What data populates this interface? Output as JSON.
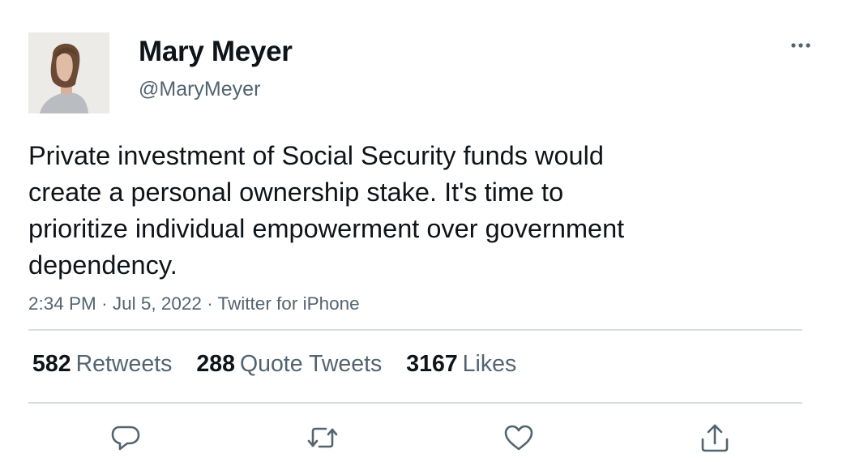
{
  "user": {
    "name": "Mary Meyer",
    "handle": "@MaryMeyer"
  },
  "tweet": {
    "text": "Private investment of Social Security funds would\ncreate a personal ownership stake. It's time to\nprioritize individual empowerment over government\ndependency.",
    "time": "2:34 PM",
    "date": "Jul 5, 2022",
    "source": "Twitter for iPhone",
    "separator": "·"
  },
  "stats": {
    "retweets_count": "582",
    "retweets_label": "Retweets",
    "quotes_count": "288",
    "quotes_label": "Quote Tweets",
    "likes_count": "3167",
    "likes_label": "Likes"
  },
  "icons": {
    "more": "more-horizontal-icon",
    "reply": "reply-icon",
    "retweet": "retweet-icon",
    "like": "heart-icon",
    "share": "share-icon"
  },
  "colors": {
    "text": "#0f1419",
    "secondary": "#536471",
    "divider": "#d8dde0"
  }
}
